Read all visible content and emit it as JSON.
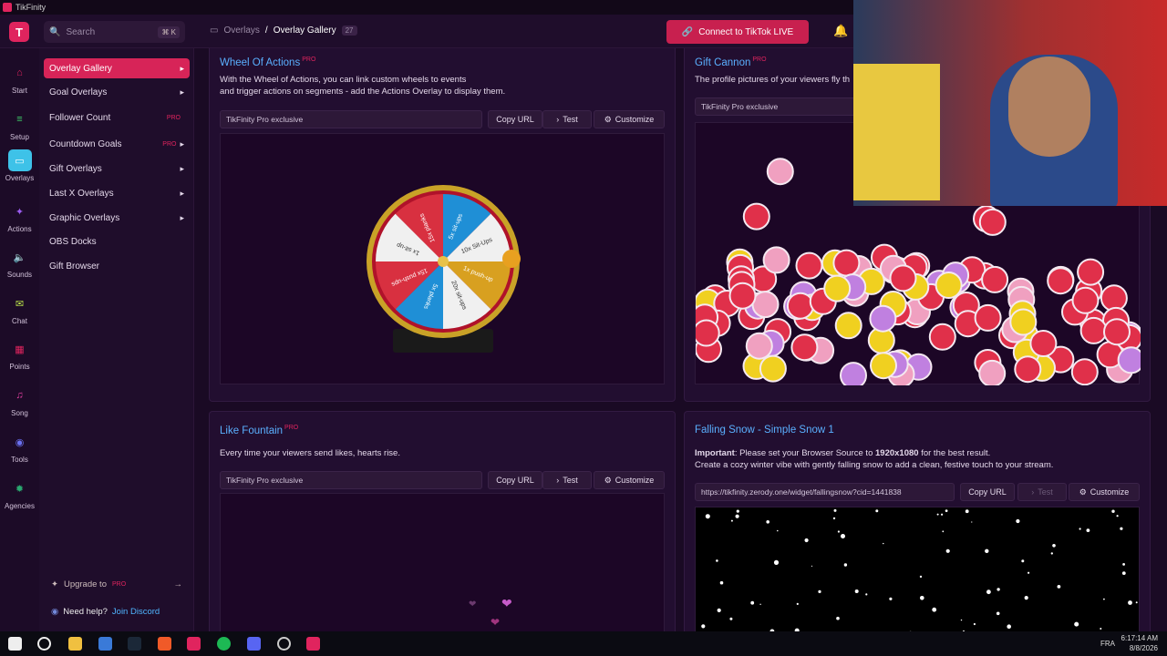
{
  "window": {
    "title": "TikFinity"
  },
  "topbar": {
    "search_placeholder": "Search",
    "search_shortcut": "⌘ K",
    "breadcrumb_root": "Overlays",
    "breadcrumb_sep": "/",
    "breadcrumb_current": "Overlay Gallery",
    "breadcrumb_count": "27",
    "connect_label": "Connect to TikTok LIVE"
  },
  "rail": [
    {
      "label": "Start"
    },
    {
      "label": "Setup"
    },
    {
      "label": "Overlays"
    },
    {
      "label": "Actions"
    },
    {
      "label": "Sounds"
    },
    {
      "label": "Chat"
    },
    {
      "label": "Points"
    },
    {
      "label": "Song"
    },
    {
      "label": "Tools"
    },
    {
      "label": "Agencies"
    }
  ],
  "sidebar": {
    "items": [
      {
        "label": "Overlay Gallery"
      },
      {
        "label": "Goal Overlays"
      },
      {
        "label": "Follower Count",
        "badge": "PRO"
      },
      {
        "label": "Countdown Goals",
        "badge": "PRO"
      },
      {
        "label": "Gift Overlays"
      },
      {
        "label": "Last X Overlays"
      },
      {
        "label": "Graphic Overlays"
      },
      {
        "label": "OBS Docks"
      },
      {
        "label": "Gift Browser"
      }
    ],
    "upgrade_label": "Upgrade to",
    "upgrade_badge": "PRO",
    "help_label": "Need help?",
    "help_link": "Join Discord"
  },
  "cards": {
    "wheel": {
      "title": "Wheel Of Actions",
      "pro": "PRO",
      "desc1": "With the Wheel of Actions, you can link custom wheels to events",
      "desc2": "and trigger actions on segments - add the Actions Overlay to display them.",
      "field": "TikFinity Pro exclusive",
      "copy": "Copy URL",
      "test": "Test",
      "customize": "Customize"
    },
    "cannon": {
      "title": "Gift Cannon",
      "pro": "PRO",
      "desc": "The profile pictures of your viewers fly th",
      "field": "TikFinity Pro exclusive"
    },
    "fountain": {
      "title": "Like Fountain",
      "pro": "PRO",
      "desc": "Every time your viewers send likes, hearts rise.",
      "field": "TikFinity Pro exclusive",
      "copy": "Copy URL",
      "test": "Test",
      "customize": "Customize"
    },
    "snow": {
      "title": "Falling Snow - Simple Snow 1",
      "important_label": "Important",
      "important_text": ": Please set your Browser Source to ",
      "resolution": "1920x1080",
      "important_tail": " for the best result.",
      "desc": "Create a cozy winter vibe with gently falling snow to add a clean, festive touch to your stream.",
      "field": "https://tikfinity.zerody.one/widget/fallingsnow?cid=1441838",
      "copy": "Copy URL",
      "test": "Test",
      "customize": "Customize"
    }
  },
  "wheel_segments": [
    "5x sit-ups",
    "10x Sit-Ups",
    "1x push-up",
    "20x sit-ups",
    "5x planks",
    "15x push-ups",
    "1x sit-up",
    "15x planks"
  ],
  "taskbar": {
    "lang": "FRA",
    "time": "6:17:14 AM",
    "date": "8/8/2026"
  },
  "colors": {
    "accent": "#d72458",
    "link": "#5ab0ff",
    "active_rail": "#3ec2e8"
  }
}
